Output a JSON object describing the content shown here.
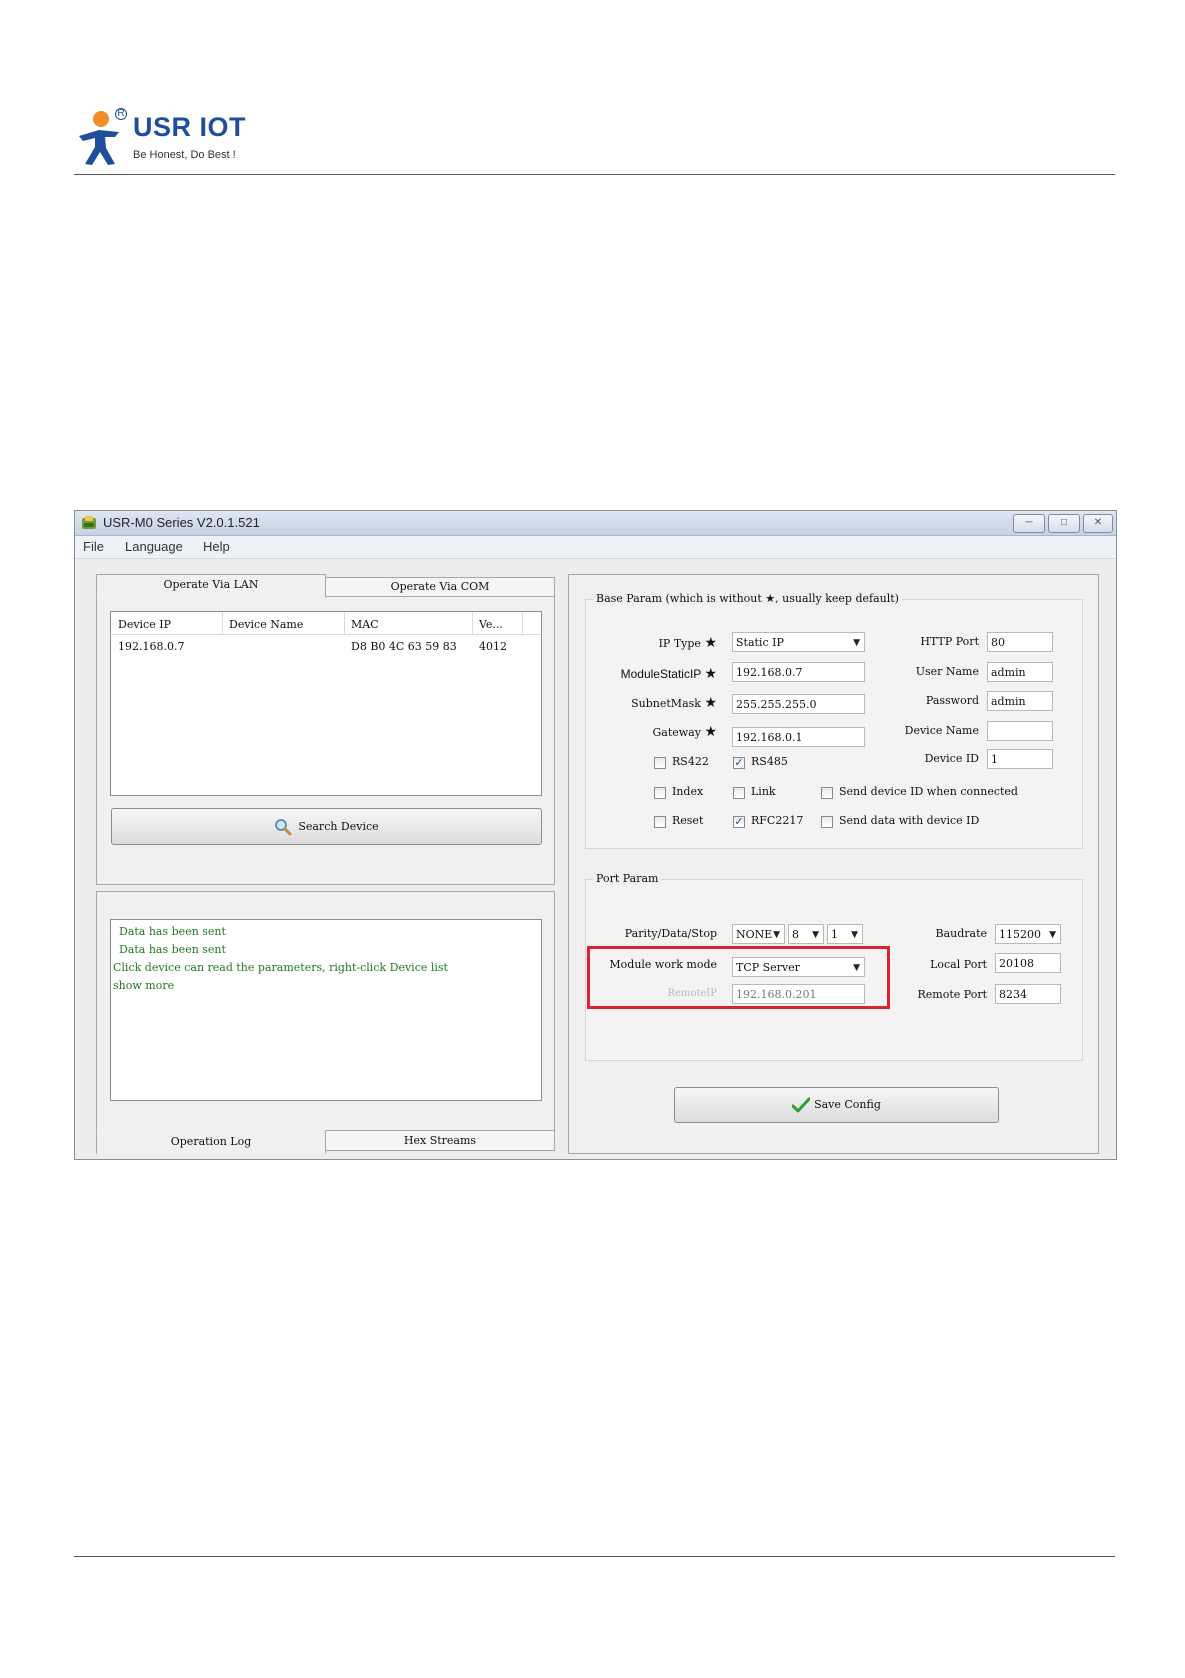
{
  "header": {
    "brand": "USR IOT",
    "registered": "R",
    "tagline": "Be Honest, Do Best !"
  },
  "window": {
    "title": "USR-M0 Series V2.0.1.521",
    "menu": [
      "File",
      "Language",
      "Help"
    ]
  },
  "left": {
    "tabs": {
      "lan": "Operate Via LAN",
      "com": "Operate Via COM"
    },
    "device_table": {
      "headers": [
        "Device IP",
        "Device Name",
        "MAC",
        "Ve..."
      ],
      "rows": [
        {
          "ip": "192.168.0.7",
          "name": "",
          "mac": "D8 B0 4C 63 59 83",
          "ver": "4012"
        }
      ]
    },
    "search_button": "Search Device",
    "log_lines": [
      "Data has been sent",
      "Data has been sent",
      "Click device can read the parameters, right-click Device list",
      "show more"
    ],
    "bottom_tabs": {
      "log": "Operation Log",
      "hex": "Hex Streams"
    }
  },
  "base_param": {
    "title": "Base Param (which is without ★, usually keep default)",
    "ip_type_label": "IP Type",
    "ip_type_value": "Static IP",
    "static_ip_label": "ModuleStaticIP",
    "static_ip_value": "192.168.0.7",
    "subnet_label": "SubnetMask",
    "subnet_value": "255.255.255.0",
    "gateway_label": "Gateway",
    "gateway_value": "192.168.0.1",
    "http_port_label": "HTTP Port",
    "http_port_value": "80",
    "user_label": "User Name",
    "user_value": "admin",
    "password_label": "Password",
    "password_value": "admin",
    "device_name_label": "Device Name",
    "device_name_value": "",
    "device_id_label": "Device ID",
    "device_id_value": "1",
    "checkboxes": {
      "rs422": {
        "label": "RS422",
        "checked": false
      },
      "rs485": {
        "label": "RS485",
        "checked": true
      },
      "index": {
        "label": "Index",
        "checked": false
      },
      "link": {
        "label": "Link",
        "checked": false
      },
      "send_id_connected": {
        "label": "Send device ID when connected",
        "checked": false
      },
      "reset": {
        "label": "Reset",
        "checked": false
      },
      "rfc2217": {
        "label": "RFC2217",
        "checked": true
      },
      "send_data_id": {
        "label": "Send data with device ID",
        "checked": false
      }
    }
  },
  "port_param": {
    "title": "Port Param",
    "parity_label": "Parity/Data/Stop",
    "parity_value": "NONE",
    "data_value": "8",
    "stop_value": "1",
    "baudrate_label": "Baudrate",
    "baudrate_value": "115200",
    "work_mode_label": "Module work mode",
    "work_mode_value": "TCP Server",
    "local_port_label": "Local Port",
    "local_port_value": "20108",
    "remote_ip_label": "RemoteIP",
    "remote_ip_value": "192.168.0.201",
    "remote_port_label": "Remote Port",
    "remote_port_value": "8234"
  },
  "save_button": "Save Config",
  "colors": {
    "highlight": "#d9232e",
    "brand": "#1f4e9c",
    "log_text": "#1f7a1f"
  }
}
